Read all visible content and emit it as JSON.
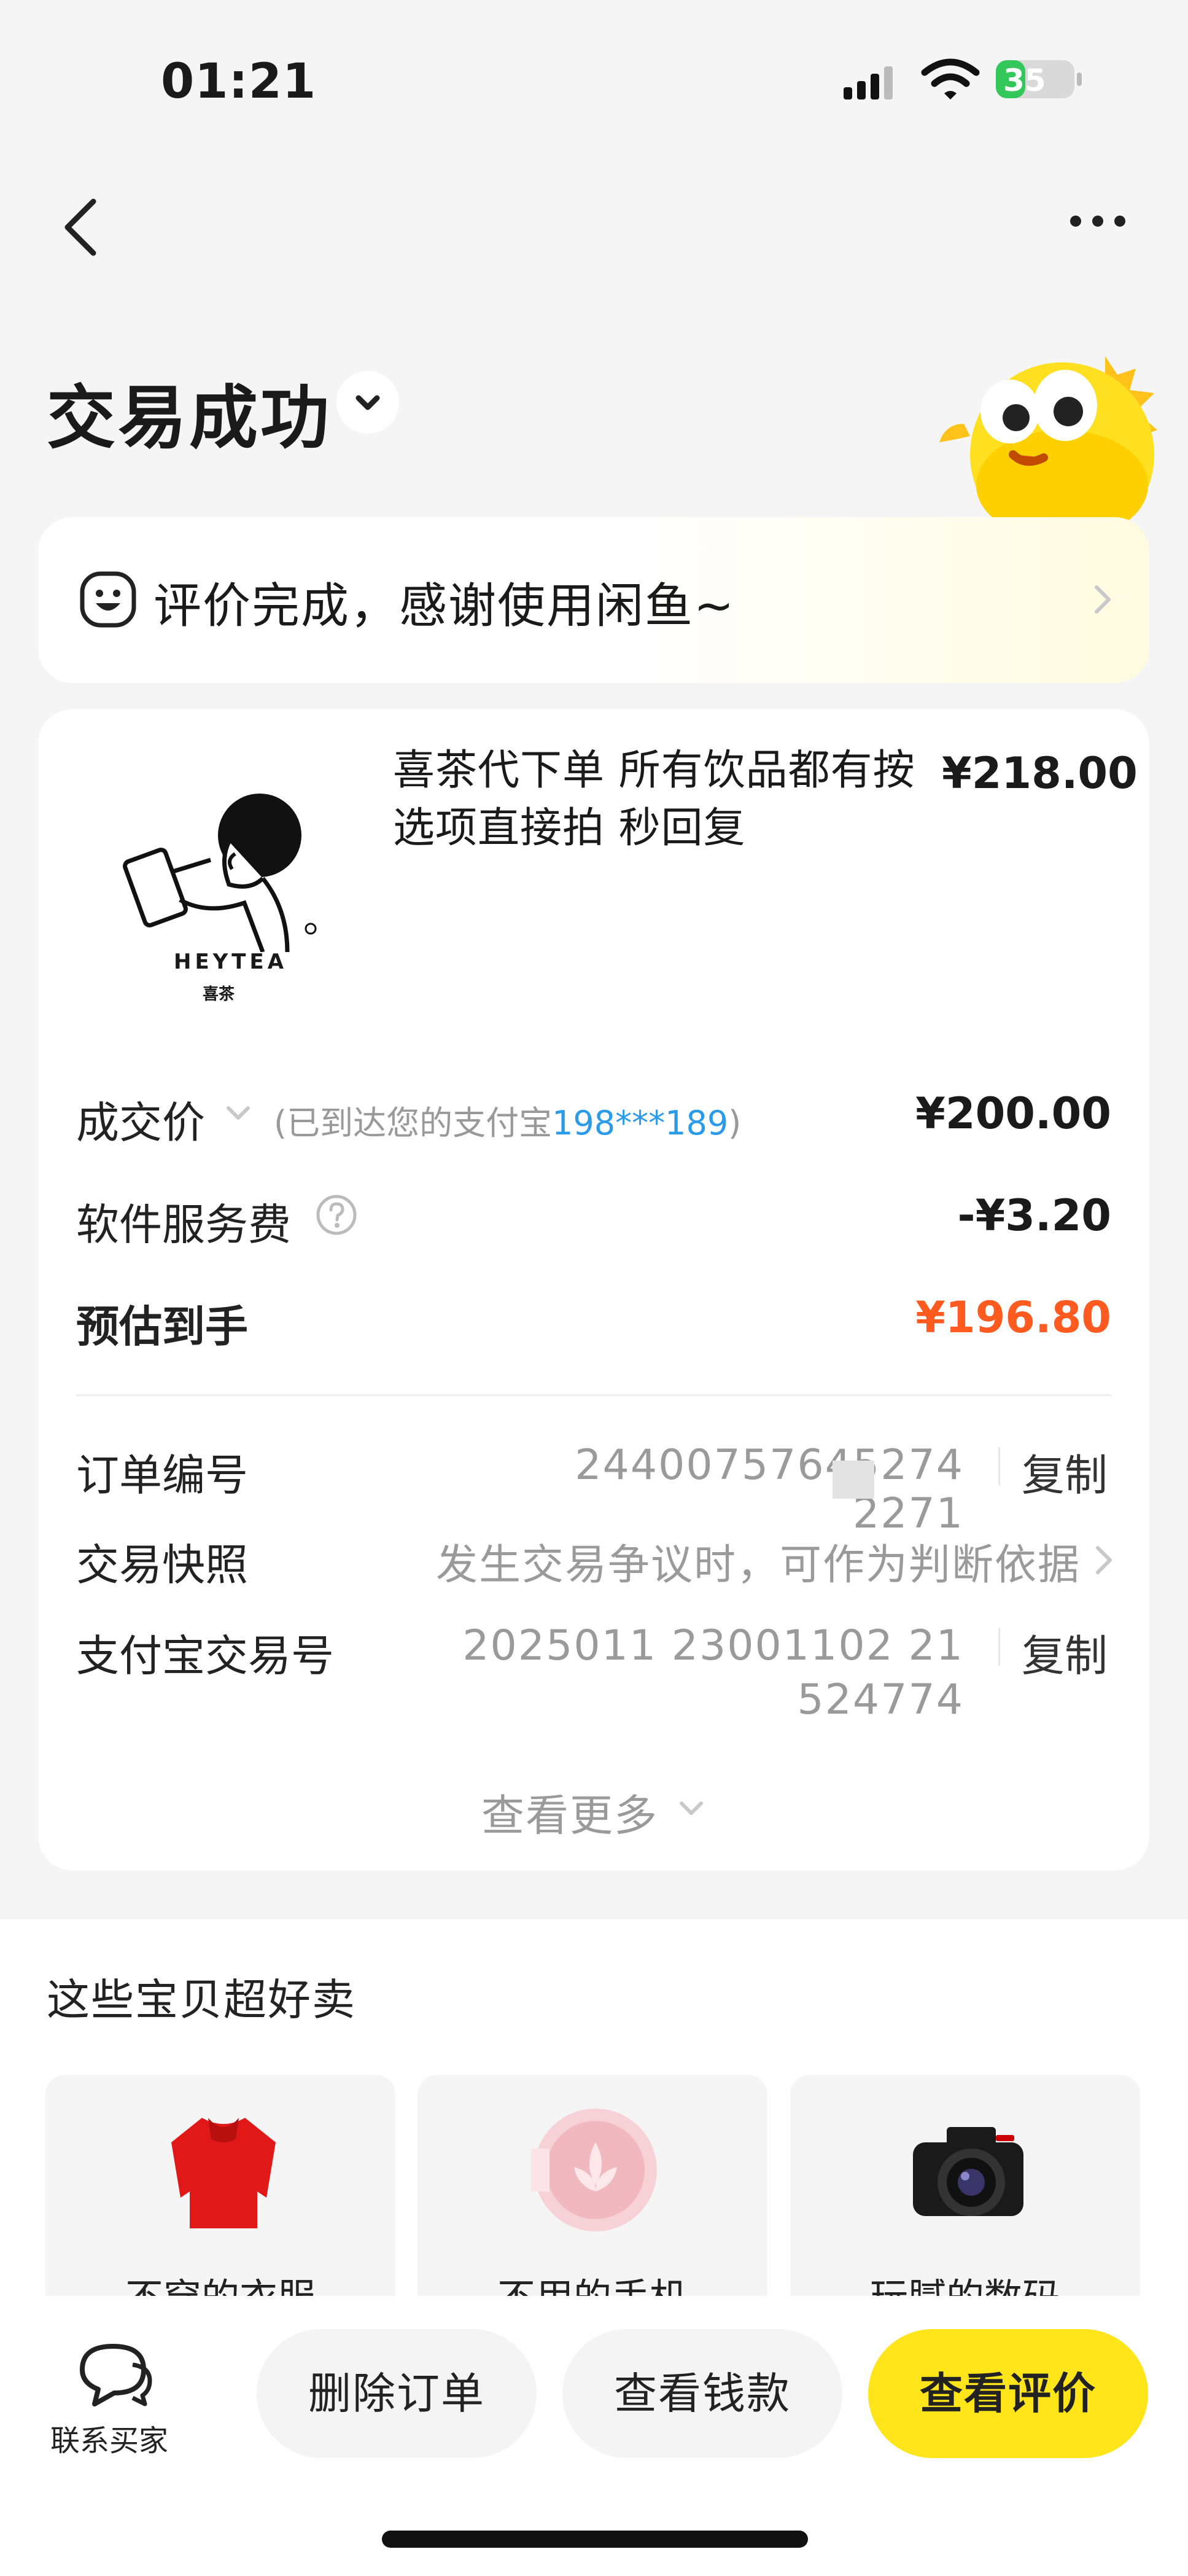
{
  "status_bar": {
    "time": "01:21",
    "battery": "35"
  },
  "header": {
    "title": "交易成功"
  },
  "review_banner": {
    "text": "评价完成，感谢使用闲鱼~"
  },
  "order": {
    "item_title": "喜茶代下单 所有饮品都有按选项直接拍 秒回复",
    "item_price": "¥218.00",
    "thumb_brand": "HEYTEA",
    "thumb_brand_cn": "喜茶",
    "deal_label": "成交价",
    "deal_note_prefix": "(已到达您的支付宝",
    "deal_note_account": "198***189",
    "deal_note_suffix": ")",
    "deal_value": "¥200.00",
    "fee_label": "软件服务费",
    "fee_value": "-¥3.20",
    "estimate_label": "预估到手",
    "estimate_value": "¥196.80",
    "order_no_label": "订单编号",
    "order_no_value": "24400757645274 2271",
    "copy_label": "复制",
    "snapshot_label": "交易快照",
    "snapshot_value": "发生交易争议时，可作为判断依据",
    "alipay_label": "支付宝交易号",
    "alipay_value_line1": "2025011 23001102  21",
    "alipay_value_line2": "524774",
    "more_label": "查看更多"
  },
  "recommend": {
    "title": "这些宝贝超好卖",
    "items": [
      {
        "label": "不穿的衣服",
        "icon": "red-sweater-icon"
      },
      {
        "label": "不用的手机",
        "icon": "pink-phone-icon"
      },
      {
        "label": "玩腻的数码",
        "icon": "camera-icon"
      }
    ]
  },
  "actions": {
    "contact_label": "联系买家",
    "delete_label": "删除订单",
    "money_label": "查看钱款",
    "review_label": "查看评价"
  },
  "colors": {
    "accent_yellow": "#ffe51a",
    "price_orange": "#ff5a1f",
    "link_blue": "#2a9be8",
    "background": "#f5f5f6"
  }
}
